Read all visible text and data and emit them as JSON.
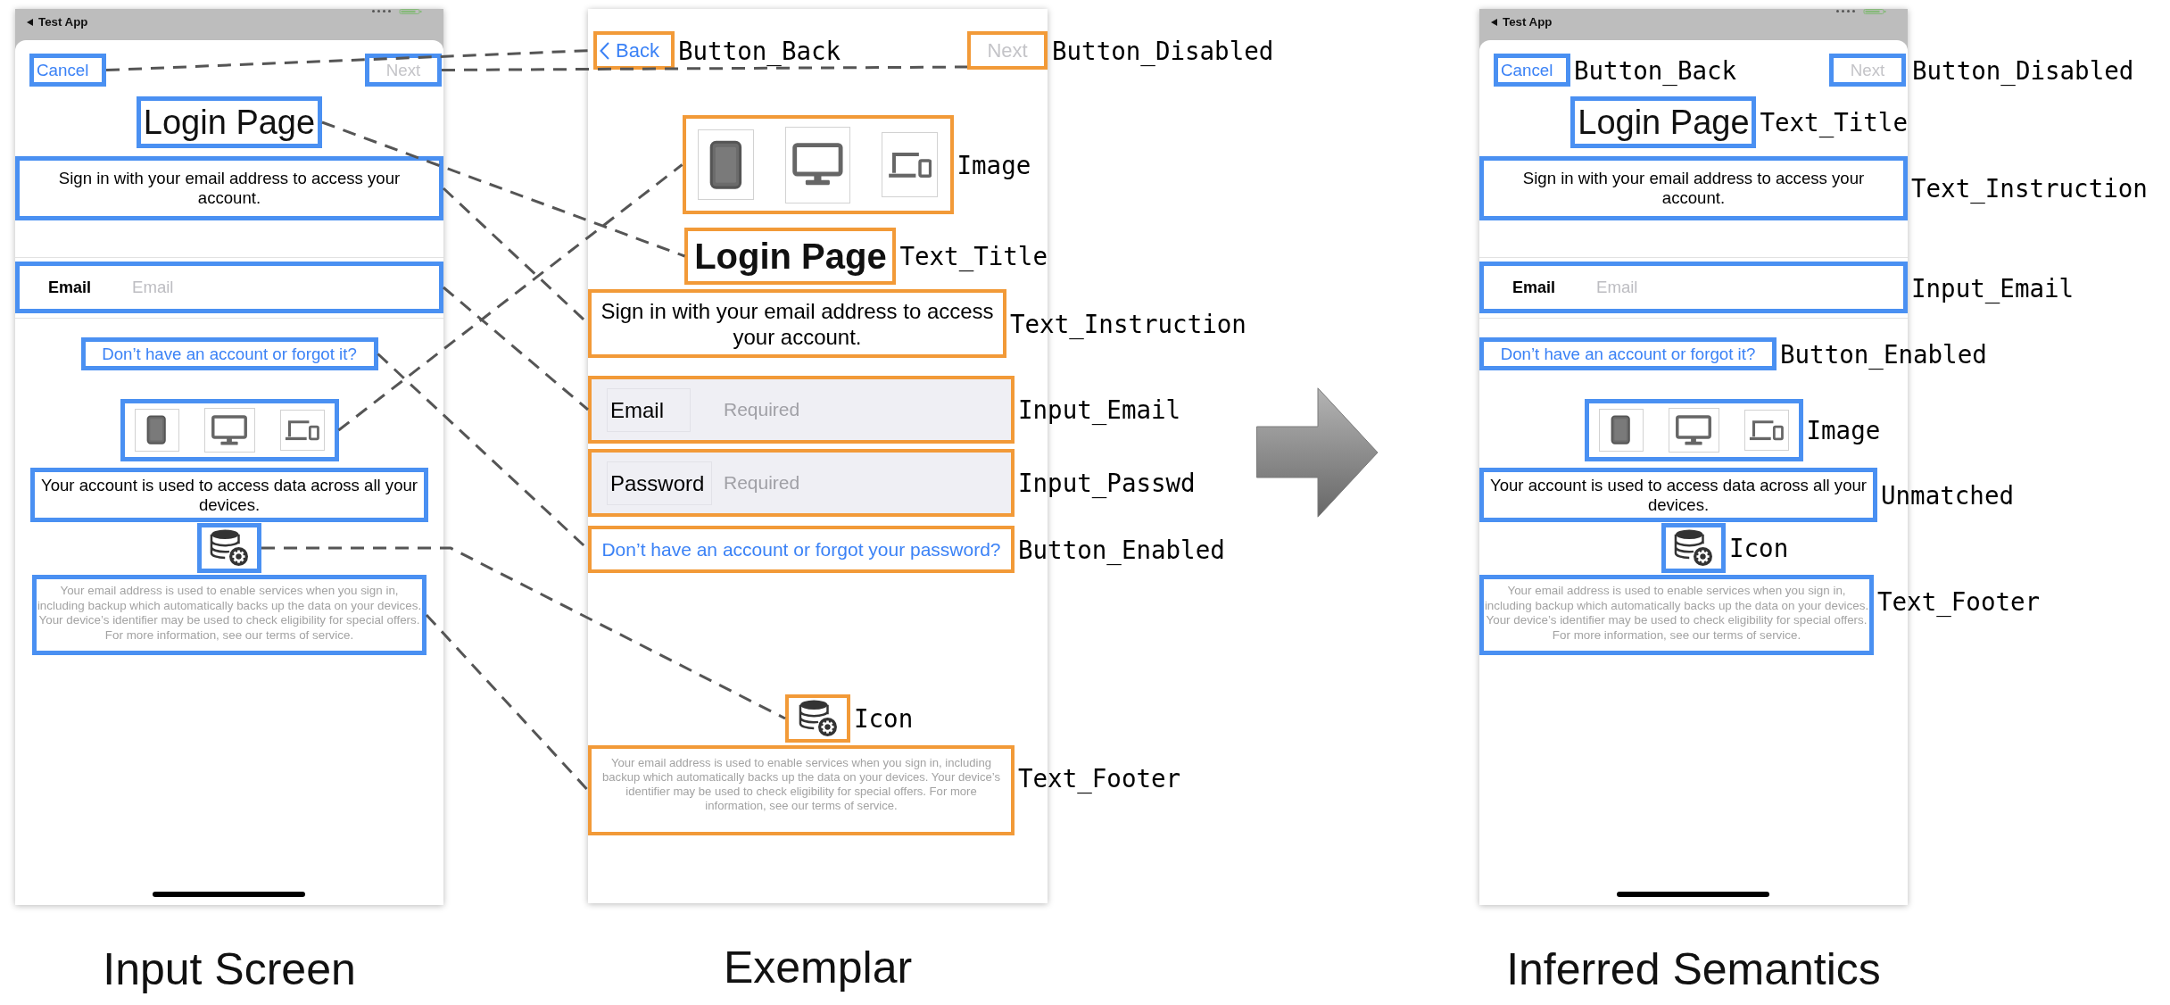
{
  "panels": [
    {
      "caption": "Input Screen",
      "kind": "sheet",
      "color": "#4a90f2",
      "status_bar": {
        "title": "Test App"
      },
      "elements": [
        {
          "kind": "nav",
          "buttons": [
            {
              "kind": "cancel",
              "text": "Cancel",
              "disabled": false
            },
            {
              "kind": "next",
              "text": "Next",
              "disabled": true
            }
          ]
        },
        {
          "kind": "title",
          "text": "Login Page"
        },
        {
          "kind": "instruction",
          "text": "Sign in with your email address to access your account."
        },
        {
          "kind": "input",
          "field_label": "Email",
          "placeholder": "Email"
        },
        {
          "kind": "link",
          "text": "Don’t have an account or forgot it?"
        },
        {
          "kind": "image"
        },
        {
          "kind": "note",
          "text": "Your account is used to access data across all your devices."
        },
        {
          "kind": "icon"
        },
        {
          "kind": "footer",
          "text": "Your email address is used to enable services when you sign in, including backup which automatically backs up the data on your devices. Your device’s identifier may be used to check eligibility for special offers. For more information, see our terms of service."
        }
      ]
    },
    {
      "caption": "Exemplar",
      "kind": "plain",
      "color": "#f29a38",
      "elements": [
        {
          "kind": "nav",
          "buttons": [
            {
              "kind": "back",
              "text": "Back",
              "disabled": false,
              "annotation": "Button_Back"
            },
            {
              "kind": "next",
              "text": "Next",
              "disabled": true,
              "annotation": "Button_Disabled"
            }
          ]
        },
        {
          "kind": "image",
          "annotation": "Image"
        },
        {
          "kind": "title",
          "text": "Login Page",
          "annotation": "Text_Title"
        },
        {
          "kind": "instruction",
          "text": "Sign in with your email address to access your account.",
          "annotation": "Text_Instruction"
        },
        {
          "kind": "input",
          "field_label": "Email",
          "placeholder": "Required",
          "annotation": "Input_Email"
        },
        {
          "kind": "input",
          "field_label": "Password",
          "placeholder": "Required",
          "annotation": "Input_Passwd"
        },
        {
          "kind": "link",
          "text": "Don’t have an account or forgot your password?",
          "annotation": "Button_Enabled"
        },
        {
          "kind": "icon",
          "annotation": "Icon"
        },
        {
          "kind": "footer",
          "text": "Your email address is used to enable services when you sign in, including backup which automatically backs up the data on your devices. Your device’s identifier may be used to check eligibility for special offers. For more information, see our terms of service.",
          "annotation": "Text_Footer"
        }
      ]
    },
    {
      "caption": "Inferred Semantics",
      "kind": "sheet",
      "color": "#4a90f2",
      "status_bar": {
        "title": "Test App"
      },
      "elements": [
        {
          "kind": "nav",
          "buttons": [
            {
              "kind": "cancel",
              "text": "Cancel",
              "disabled": false,
              "annotation": "Button_Back"
            },
            {
              "kind": "next",
              "text": "Next",
              "disabled": true,
              "annotation": "Button_Disabled"
            }
          ]
        },
        {
          "kind": "title",
          "text": "Login Page",
          "annotation": "Text_Title"
        },
        {
          "kind": "instruction",
          "text": "Sign in with your email address to access your account.",
          "annotation": "Text_Instruction"
        },
        {
          "kind": "input",
          "field_label": "Email",
          "placeholder": "Email",
          "annotation": "Input_Email"
        },
        {
          "kind": "link",
          "text": "Don’t have an account or forgot it?",
          "annotation": "Button_Enabled"
        },
        {
          "kind": "image",
          "annotation": "Image"
        },
        {
          "kind": "note",
          "text": "Your account is used to access data across all your devices.",
          "annotation": "Unmatched"
        },
        {
          "kind": "icon",
          "annotation": "Icon"
        },
        {
          "kind": "footer",
          "text": "Your email address is used to enable services when you sign in, including backup which automatically backs up the data on your devices. Your device’s identifier may be used to check eligibility for special offers. For more information, see our terms of service.",
          "annotation": "Text_Footer"
        }
      ]
    }
  ]
}
